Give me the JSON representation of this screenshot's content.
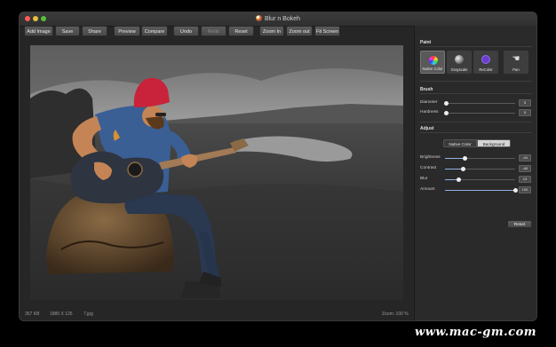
{
  "window": {
    "title": "Blur n Bokeh"
  },
  "toolbar": {
    "add_image": "Add Image",
    "save": "Save",
    "share": "Share",
    "preview": "Preview",
    "compare": "Compare",
    "undo": "Undo",
    "redo": "Redo",
    "reset": "Reset",
    "zoom_in": "Zoom In",
    "zoom_out": "Zoom out",
    "fit_screen": "Fit Screen"
  },
  "status": {
    "size": "357 KB",
    "dimensions": "1880 X 125",
    "filename": "7.jpg",
    "zoom": "Zoom: 100 %"
  },
  "panel": {
    "paint": {
      "title": "Paint",
      "tools": [
        {
          "label": "Native Color",
          "icon": "color-wheel-icon",
          "selected": true
        },
        {
          "label": "Grayscale",
          "icon": "grayscale-sphere-icon",
          "selected": false
        },
        {
          "label": "ReColor",
          "icon": "recolor-circle-icon",
          "selected": false
        },
        {
          "label": "Pan",
          "icon": "hand-icon",
          "selected": false
        }
      ]
    },
    "brush": {
      "title": "Brush",
      "diameter": {
        "label": "Diameter",
        "value": "5",
        "level": 0.02
      },
      "hardness": {
        "label": "Hardness",
        "value": "5",
        "level": 0.02
      }
    },
    "adjust": {
      "title": "Adjust",
      "tab_native": "Native Color",
      "tab_background": "Background",
      "active_tab": "Background",
      "brightness": {
        "label": "Brightness",
        "value": "-44",
        "level": 0.28
      },
      "contrast": {
        "label": "Contrast",
        "value": "-48",
        "level": 0.26
      },
      "blur": {
        "label": "Blur",
        "value": "13",
        "level": 0.2
      },
      "amount": {
        "label": "Amount",
        "value": "100",
        "level": 1.0
      }
    },
    "reset": "Reset"
  },
  "watermark": "www.mac-gm.com",
  "colors": {
    "accent": "#8fb3e0",
    "recolor": "#6a3fd0",
    "beanie": "#c8233a",
    "guitar_body": "#2e3440"
  }
}
